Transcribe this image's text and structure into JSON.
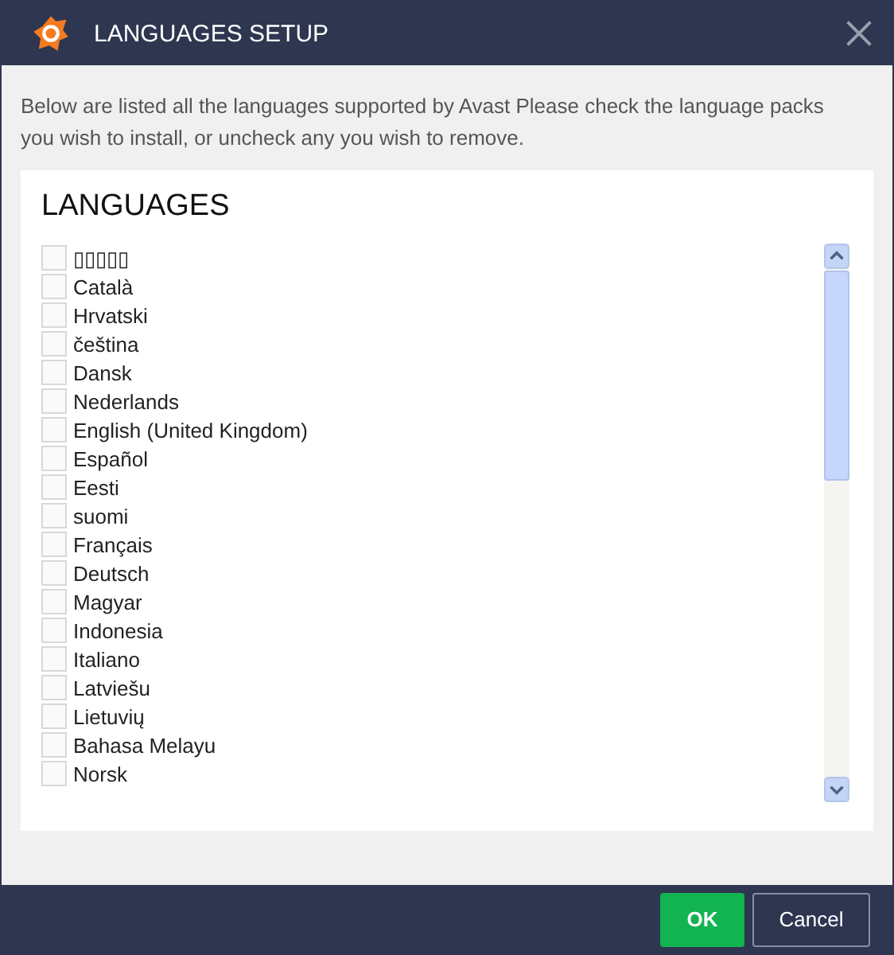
{
  "window": {
    "title": "LANGUAGES SETUP"
  },
  "intro": "Below are listed all the languages supported by Avast Please check the language packs you wish to install, or uncheck any you wish to remove.",
  "panel": {
    "heading": "LANGUAGES"
  },
  "languages": [
    {
      "label": "▯▯▯▯▯",
      "checked": false
    },
    {
      "label": "Català",
      "checked": false
    },
    {
      "label": "Hrvatski",
      "checked": false
    },
    {
      "label": "čeština",
      "checked": false
    },
    {
      "label": "Dansk",
      "checked": false
    },
    {
      "label": "Nederlands",
      "checked": false
    },
    {
      "label": "English (United Kingdom)",
      "checked": false
    },
    {
      "label": "Español",
      "checked": false
    },
    {
      "label": "Eesti",
      "checked": false
    },
    {
      "label": "suomi",
      "checked": false
    },
    {
      "label": "Français",
      "checked": false
    },
    {
      "label": "Deutsch",
      "checked": false
    },
    {
      "label": "Magyar",
      "checked": false
    },
    {
      "label": "Indonesia",
      "checked": false
    },
    {
      "label": "Italiano",
      "checked": false
    },
    {
      "label": "Latviešu",
      "checked": false
    },
    {
      "label": "Lietuvių",
      "checked": false
    },
    {
      "label": "Bahasa Melayu",
      "checked": false
    },
    {
      "label": "Norsk",
      "checked": false
    }
  ],
  "buttons": [
    {
      "label": "OK",
      "kind": "primary"
    },
    {
      "label": "Cancel",
      "kind": "secondary"
    }
  ]
}
